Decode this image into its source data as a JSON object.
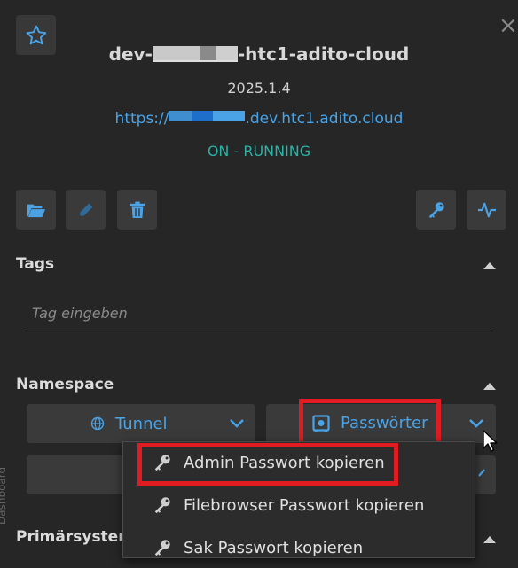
{
  "header": {
    "title_prefix": "dev-",
    "title_suffix": "-htc1-adito-cloud",
    "version": "2025.1.4",
    "url_prefix": "https://",
    "url_suffix": ".dev.htc1.adito.cloud",
    "status": "ON - RUNNING"
  },
  "toolbar": {
    "icons": [
      "folder-open-icon",
      "pencil-icon",
      "trash-icon",
      "key-icon",
      "activity-icon"
    ]
  },
  "tags": {
    "heading": "Tags",
    "placeholder": "Tag eingeben"
  },
  "namespace": {
    "heading": "Namespace",
    "tunnel_label": "Tunnel",
    "passwords_label": "Passwörter"
  },
  "password_menu": {
    "items": [
      {
        "label": "Admin Passwort kopieren"
      },
      {
        "label": "Filebrowser Passwort kopieren"
      },
      {
        "label": "Sak Passwort kopieren"
      }
    ]
  },
  "primary": {
    "heading": "Primärsysten"
  },
  "side_label": "Dashboard",
  "colors": {
    "accent": "#4aa3e6",
    "status": "#2ab3a6",
    "highlight": "#e11b22",
    "background": "#262626",
    "button": "#3a3a3a"
  }
}
